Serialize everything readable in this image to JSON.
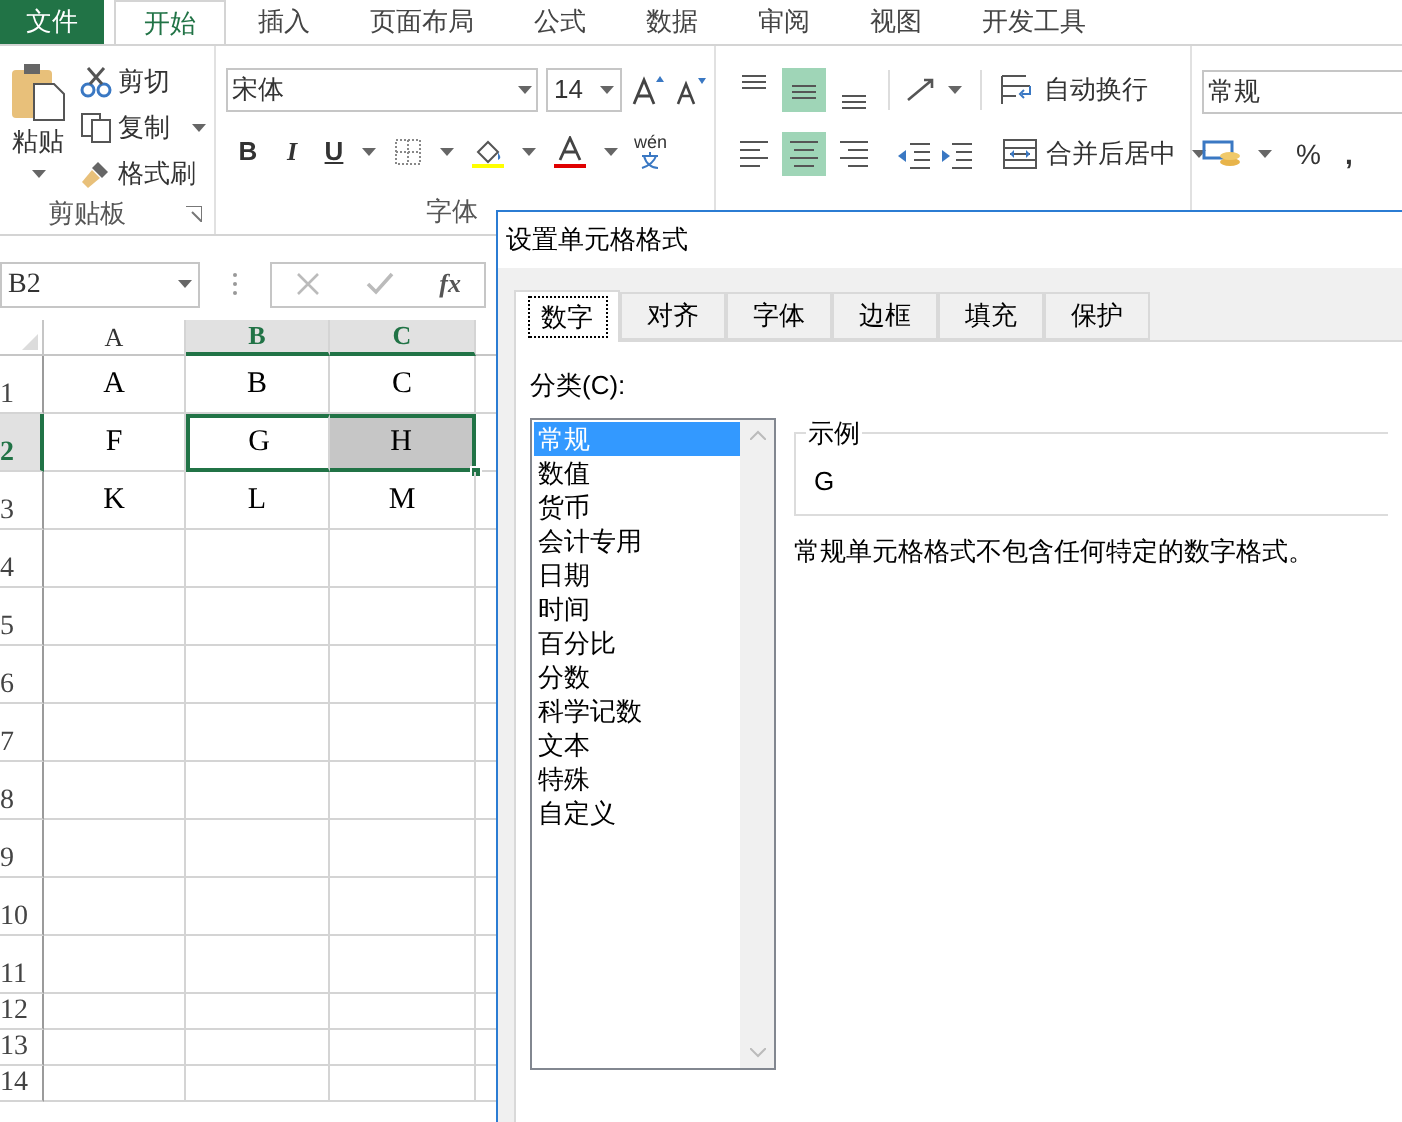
{
  "ribbon_tabs": [
    {
      "label": "文件",
      "kind": "file",
      "selected": false
    },
    {
      "label": "开始",
      "kind": "tab",
      "selected": true
    },
    {
      "label": "插入",
      "kind": "tab",
      "selected": false
    },
    {
      "label": "页面布局",
      "kind": "tab",
      "selected": false
    },
    {
      "label": "公式",
      "kind": "tab",
      "selected": false
    },
    {
      "label": "数据",
      "kind": "tab",
      "selected": false
    },
    {
      "label": "审阅",
      "kind": "tab",
      "selected": false
    },
    {
      "label": "视图",
      "kind": "tab",
      "selected": false
    },
    {
      "label": "开发工具",
      "kind": "tab",
      "selected": false
    }
  ],
  "clipboard": {
    "paste": "粘贴",
    "cut": "剪切",
    "copy": "复制",
    "format_painter": "格式刷",
    "group_label": "剪贴板"
  },
  "font": {
    "name": "宋体",
    "size": "14",
    "bold": "B",
    "italic": "I",
    "underline": "U",
    "phonetic": "wén",
    "group_label": "字体"
  },
  "alignment": {
    "vertical": [
      {
        "kind": "top",
        "selected": false
      },
      {
        "kind": "middle",
        "selected": true
      },
      {
        "kind": "bottom",
        "selected": false
      }
    ],
    "horizontal": [
      {
        "kind": "left",
        "selected": false
      },
      {
        "kind": "center",
        "selected": true
      },
      {
        "kind": "right",
        "selected": false
      }
    ],
    "wrap": "自动换行",
    "merge": "合并后居中"
  },
  "number": {
    "format": "常规",
    "percent": "%",
    "comma": ","
  },
  "formula_bar": {
    "name_box": "B2",
    "function_label": "fx"
  },
  "sheet": {
    "columns": [
      {
        "label": "A",
        "selected": false
      },
      {
        "label": "B",
        "selected": true
      },
      {
        "label": "C",
        "selected": true
      }
    ],
    "rows": [
      {
        "label": "1",
        "selected": false,
        "cells": [
          {
            "value": "A",
            "selected": false,
            "active": false
          },
          {
            "value": "B",
            "selected": false,
            "active": false
          },
          {
            "value": "C",
            "selected": false,
            "active": false
          }
        ]
      },
      {
        "label": "2",
        "selected": true,
        "cells": [
          {
            "value": "F",
            "selected": false,
            "active": false
          },
          {
            "value": "G",
            "selected": true,
            "active": true
          },
          {
            "value": "H",
            "selected": true,
            "active": false
          }
        ]
      },
      {
        "label": "3",
        "selected": false,
        "cells": [
          {
            "value": "K",
            "selected": false,
            "active": false
          },
          {
            "value": "L",
            "selected": false,
            "active": false
          },
          {
            "value": "M",
            "selected": false,
            "active": false
          }
        ]
      },
      {
        "label": "4",
        "selected": false,
        "cells": []
      },
      {
        "label": "5",
        "selected": false,
        "cells": []
      },
      {
        "label": "6",
        "selected": false,
        "cells": []
      },
      {
        "label": "7",
        "selected": false,
        "cells": []
      },
      {
        "label": "8",
        "selected": false,
        "cells": []
      },
      {
        "label": "9",
        "selected": false,
        "cells": []
      },
      {
        "label": "10",
        "selected": false,
        "cells": []
      },
      {
        "label": "11",
        "selected": false,
        "cells": []
      },
      {
        "label": "12",
        "selected": false,
        "cells": []
      },
      {
        "label": "13",
        "selected": false,
        "cells": []
      },
      {
        "label": "14",
        "selected": false,
        "cells": []
      }
    ]
  },
  "dialog": {
    "title": "设置单元格格式",
    "tabs": [
      {
        "label": "数字",
        "selected": true
      },
      {
        "label": "对齐",
        "selected": false
      },
      {
        "label": "字体",
        "selected": false
      },
      {
        "label": "边框",
        "selected": false
      },
      {
        "label": "填充",
        "selected": false
      },
      {
        "label": "保护",
        "selected": false
      }
    ],
    "category_label": "分类(C):",
    "categories": [
      {
        "label": "常规",
        "selected": true
      },
      {
        "label": "数值",
        "selected": false
      },
      {
        "label": "货币",
        "selected": false
      },
      {
        "label": "会计专用",
        "selected": false
      },
      {
        "label": "日期",
        "selected": false
      },
      {
        "label": "时间",
        "selected": false
      },
      {
        "label": "百分比",
        "selected": false
      },
      {
        "label": "分数",
        "selected": false
      },
      {
        "label": "科学记数",
        "selected": false
      },
      {
        "label": "文本",
        "selected": false
      },
      {
        "label": "特殊",
        "selected": false
      },
      {
        "label": "自定义",
        "selected": false
      }
    ],
    "sample": {
      "label": "示例",
      "value": "G"
    },
    "description": "常规单元格格式不包含任何特定的数字格式。"
  }
}
